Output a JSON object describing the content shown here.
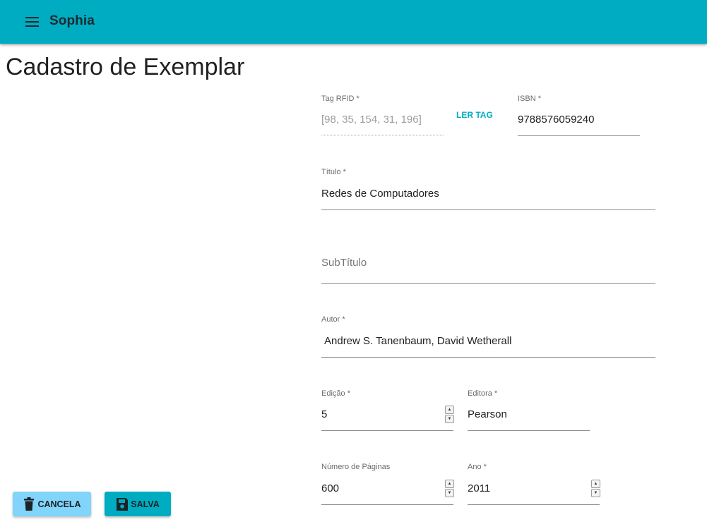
{
  "appbar": {
    "title": "Sophia",
    "menu_icon": "menu-icon"
  },
  "page": {
    "title": "Cadastro de Exemplar"
  },
  "form": {
    "tag_rfid": {
      "label": "Tag RFID *",
      "value": "[98, 35, 154, 31, 196]",
      "disabled": true
    },
    "ler_tag_label": "LER TAG",
    "isbn": {
      "label": "ISBN *",
      "value": "9788576059240"
    },
    "titulo": {
      "label": "Título *",
      "value": "Redes de Computadores"
    },
    "subtitulo": {
      "placeholder": "SubTítulo"
    },
    "autor": {
      "label": "Autor *",
      "value": "Andrew S. Tanenbaum, David Wetherall"
    },
    "edicao": {
      "label": "Edição *",
      "value": "5"
    },
    "editora": {
      "label": "Editora *",
      "value": "Pearson"
    },
    "numero_paginas": {
      "label": "Número de Páginas",
      "value": "600"
    },
    "ano": {
      "label": "Ano *",
      "value": "2011"
    }
  },
  "actions": {
    "cancel_label": "CANCELA",
    "cancel_icon": "trash-icon",
    "save_label": "SALVA",
    "save_icon": "floppy-disk-icon"
  },
  "colors": {
    "primary": "#00acc1",
    "cancel_button": "#81d4fa",
    "text": "#212121"
  }
}
